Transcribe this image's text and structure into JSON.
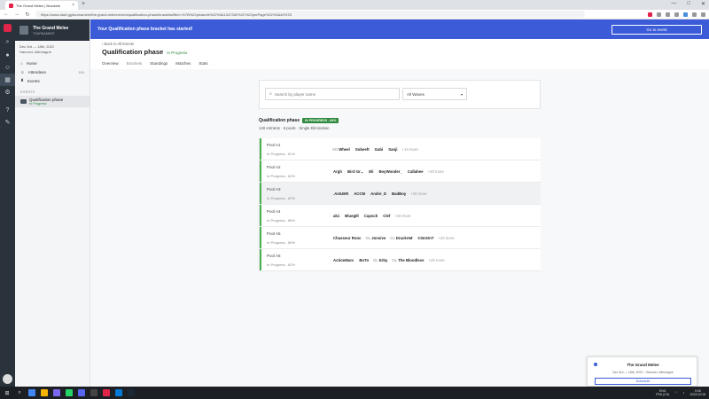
{
  "browser": {
    "tab_title": "The Grand Melee | Brackets",
    "new_tab": "+",
    "close_tab": "×",
    "url": "https://www.start.gg/tournament/the-grand-melee/event/qualification-phase/brackets/filter=%7B%22phaseId%22%3A1347352%2C%22perPage%22%3A40%7D",
    "window_controls": [
      "—",
      "□",
      "✕"
    ],
    "nav": [
      "←",
      "→",
      "↻"
    ]
  },
  "sidebar": {
    "event_title": "The Grand Melee",
    "event_subtitle": "TOURNAMENT",
    "dates": "Dec 3rd — 18th, 2022",
    "location": "Hanover, Allemagne",
    "nav_items": [
      {
        "label": "Home",
        "count": ""
      },
      {
        "label": "Attendees",
        "count": "150"
      },
      {
        "label": "Events",
        "count": ""
      }
    ],
    "events_section_label": "EVENTS",
    "phase_item_title": "Qualification phase",
    "phase_item_status": "In Progress"
  },
  "banner": {
    "text": "Your Qualification phase bracket has started!",
    "button": "Go to event"
  },
  "header": {
    "back_link": "‹ Back to All Events",
    "title": "Qualification phase",
    "status": "In Progress",
    "tabs": [
      "Overview",
      "Brackets",
      "Standings",
      "Matches",
      "Stats"
    ]
  },
  "filters": {
    "search_placeholder": "Search by player name",
    "waves_select": "All Waves"
  },
  "bracket": {
    "title": "Qualification phase",
    "badge": "IN PROGRESS - 84%",
    "subtitle": "140 entrants · 6 pools · Single Elimination"
  },
  "pools": [
    {
      "name": "Pool A1",
      "status": "In Progress - 81%",
      "players": [
        {
          "prefix": "SG",
          "name": "Wheel"
        },
        {
          "prefix": "",
          "name": "Sobeeft"
        },
        {
          "prefix": "",
          "name": "Gabi"
        },
        {
          "prefix": "",
          "name": "Sanji"
        }
      ],
      "more": "+14 more"
    },
    {
      "name": "Pool A2",
      "status": "In Progress - 82%",
      "players": [
        {
          "prefix": "",
          "name": "Argh"
        },
        {
          "prefix": "",
          "name": "Bird Gr..."
        },
        {
          "prefix": "",
          "name": "Eli"
        },
        {
          "prefix": "",
          "name": "BoyWonder_"
        },
        {
          "prefix": "",
          "name": "Callahee"
        }
      ],
      "more": "+20 more"
    },
    {
      "name": "Pool A3",
      "status": "In Progress - 82%",
      "players": [
        {
          "prefix": "",
          "name": ".AstUER"
        },
        {
          "prefix": "",
          "name": "ACCM"
        },
        {
          "prefix": "",
          "name": "Andre_D"
        },
        {
          "prefix": "",
          "name": "BadBoy"
        }
      ],
      "more": "+20 more"
    },
    {
      "name": "Pool A4",
      "status": "In Progress - 86%",
      "players": [
        {
          "prefix": "",
          "name": "ak1"
        },
        {
          "prefix": "",
          "name": "BluegIll"
        },
        {
          "prefix": "",
          "name": "Capsch"
        },
        {
          "prefix": "",
          "name": "Clef"
        }
      ],
      "more": "+20 more"
    },
    {
      "name": "Pool A5",
      "status": "In Progress - 86%",
      "players": [
        {
          "prefix": "",
          "name": "Chasseur Ronc"
        },
        {
          "prefix": "GL",
          "name": "Jonsive"
        },
        {
          "prefix": "CL",
          "name": "DrackAM"
        },
        {
          "prefix": "",
          "name": "C0mOnT"
        }
      ],
      "more": "+20 more"
    },
    {
      "name": "Pool A6",
      "status": "In Progress - 82%",
      "players": [
        {
          "prefix": "",
          "name": "ActionMarc"
        },
        {
          "prefix": "",
          "name": "BoTo"
        },
        {
          "prefix": "GL",
          "name": "Erby"
        },
        {
          "prefix": "GL",
          "name": "The Bloodless"
        }
      ],
      "more": "+20 more"
    }
  ],
  "notification": {
    "title": "The Grand Melee",
    "subtitle": "Dec 3rd — 18th, 2022 · Hanover, Allemagne",
    "button": "Schedule"
  },
  "taskbar": {
    "tray_lang": "ENG",
    "tray_region": "FRA (CH)",
    "time": "0:06",
    "date": "2022/12/18"
  },
  "colors": {
    "banner_blue": "#3b5bd9",
    "progress_green": "#2f8a3e",
    "sidebar_dark": "#2a323c"
  }
}
